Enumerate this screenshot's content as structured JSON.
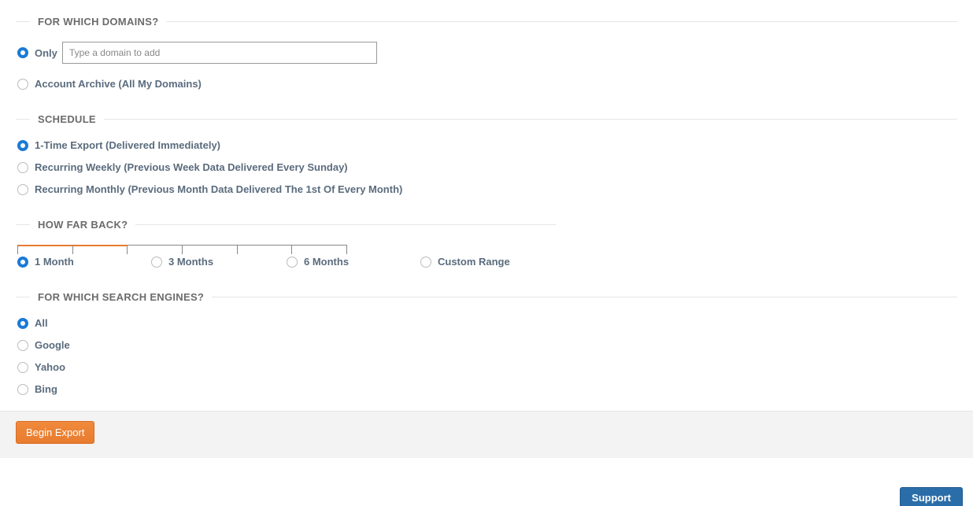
{
  "sections": {
    "domains": {
      "title": "FOR WHICH DOMAINS?",
      "options": {
        "only": "Only",
        "only_placeholder": "Type a domain to add",
        "archive": "Account Archive (All My Domains)"
      }
    },
    "schedule": {
      "title": "SCHEDULE",
      "options": {
        "once": "1-Time Export (Delivered Immediately)",
        "weekly": "Recurring Weekly (Previous Week Data Delivered Every Sunday)",
        "monthly": "Recurring Monthly (Previous Month Data Delivered The 1st Of Every Month)"
      }
    },
    "how_far": {
      "title": "HOW FAR BACK?",
      "options": {
        "m1": "1 Month",
        "m3": "3 Months",
        "m6": "6 Months",
        "custom": "Custom Range"
      }
    },
    "engines": {
      "title": "FOR WHICH SEARCH ENGINES?",
      "options": {
        "all": "All",
        "google": "Google",
        "yahoo": "Yahoo",
        "bing": "Bing"
      }
    }
  },
  "footer": {
    "begin_export": "Begin Export",
    "support": "Support"
  }
}
